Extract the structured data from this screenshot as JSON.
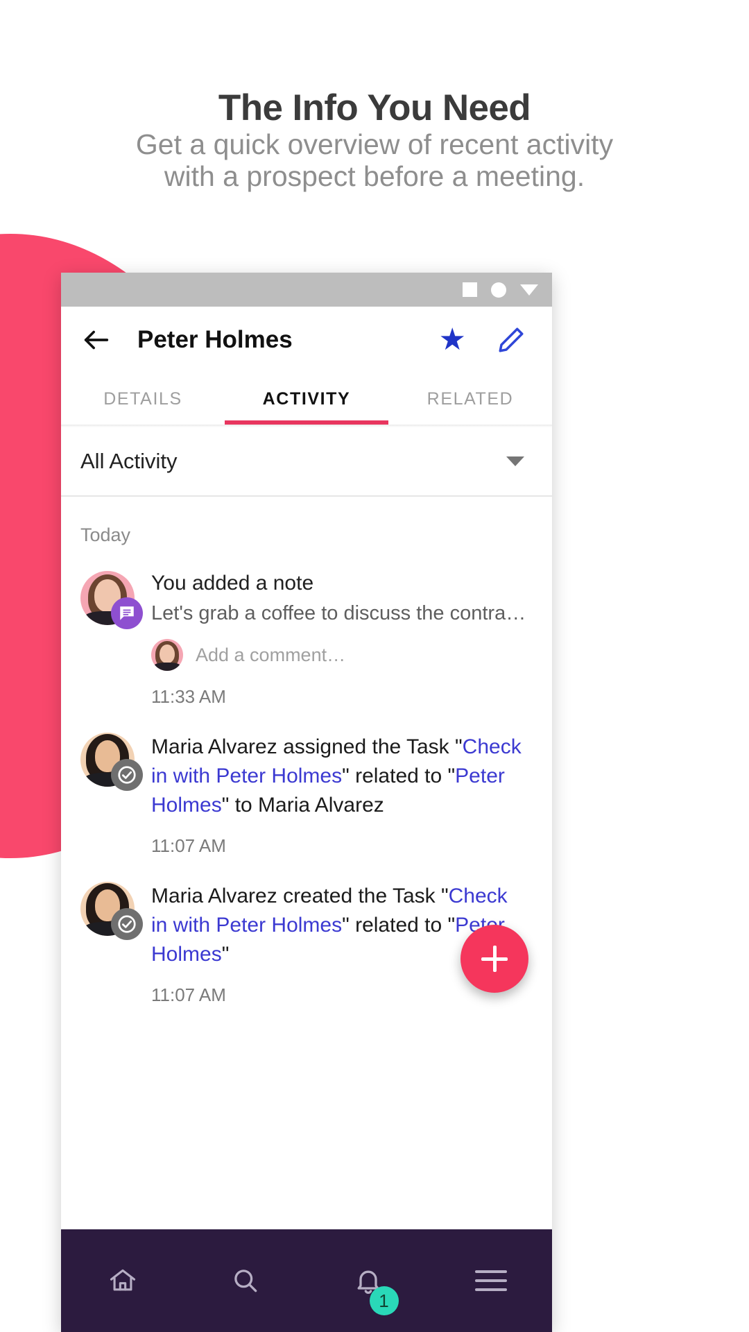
{
  "marketing": {
    "headline": "The Info You Need",
    "subtitle_line1": "Get a quick overview of recent activity",
    "subtitle_line2": "with a prospect before a meeting.",
    "accent_color": "#f9486c"
  },
  "phone": {
    "statusbar": {
      "icons": [
        "square-icon",
        "circle-icon",
        "triangle-down-icon"
      ],
      "background": "#bdbdbd"
    },
    "appbar": {
      "back_icon": "arrow-left-icon",
      "title": "Peter Holmes",
      "favorite_icon": "star-icon",
      "favorite_color": "#1f34c7",
      "edit_icon": "pencil-icon",
      "edit_color": "#2f46d8"
    },
    "tabs": [
      {
        "label": "DETAILS",
        "active": false
      },
      {
        "label": "ACTIVITY",
        "active": true
      },
      {
        "label": "RELATED",
        "active": false
      }
    ],
    "tab_indicator_color": "#e8365f",
    "filter": {
      "label": "All Activity",
      "caret_icon": "chevron-down-icon"
    },
    "activity": {
      "day_label": "Today",
      "items": [
        {
          "type": "note",
          "badge_icon": "note-icon",
          "badge_color": "#8e4fd0",
          "title": "You added a note",
          "subtitle": "Let's grab a coffee to discuss the contract with Br…",
          "comment_placeholder": "Add a comment…",
          "time": "11:33 AM"
        },
        {
          "type": "task",
          "badge_icon": "check-circle-icon",
          "badge_color": "#6f6f6f",
          "rich": [
            {
              "text": "Maria Alvarez assigned the Task \"",
              "link": false
            },
            {
              "text": "Check in with Peter Holmes",
              "link": true
            },
            {
              "text": "\" related to \"",
              "link": false
            },
            {
              "text": "Peter Holmes",
              "link": true
            },
            {
              "text": "\" to Maria Alvarez",
              "link": false
            }
          ],
          "time": "11:07 AM"
        },
        {
          "type": "task",
          "badge_icon": "check-circle-icon",
          "badge_color": "#6f6f6f",
          "rich": [
            {
              "text": "Maria Alvarez created the Task \"",
              "link": false
            },
            {
              "text": "Check in with Peter Holmes",
              "link": true
            },
            {
              "text": "\" related to \"",
              "link": false
            },
            {
              "text": "Peter Holmes",
              "link": true
            },
            {
              "text": "\"",
              "link": false
            }
          ],
          "time": "11:07 AM"
        }
      ]
    },
    "fab": {
      "icon": "plus-icon",
      "color": "#f5365c"
    },
    "bottom_nav": {
      "background": "#2c1b3f",
      "items": [
        {
          "icon": "home-icon",
          "badge": null
        },
        {
          "icon": "search-icon",
          "badge": null
        },
        {
          "icon": "bell-icon",
          "badge": "1",
          "badge_color": "#2ad8b8"
        },
        {
          "icon": "menu-icon",
          "badge": null
        }
      ]
    }
  }
}
